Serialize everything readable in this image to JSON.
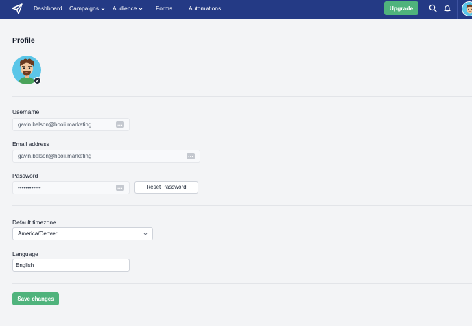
{
  "nav": {
    "items": [
      {
        "label": "Dashboard"
      },
      {
        "label": "Campaigns",
        "has_dropdown": true
      },
      {
        "label": "Audience",
        "has_dropdown": true
      },
      {
        "label": "Forms"
      },
      {
        "label": "Automations"
      }
    ],
    "upgrade_label": "Upgrade",
    "icons": [
      "paper-plane-logo-icon",
      "search-icon",
      "bell-icon",
      "user-avatar"
    ]
  },
  "page": {
    "title": "Profile"
  },
  "form": {
    "username": {
      "label": "Username",
      "value": "gavin.belson@hooli.marketing"
    },
    "email": {
      "label": "Email address",
      "value": "gavin.belson@hooli.marketing"
    },
    "password": {
      "label": "Password",
      "value": "••••••••••••",
      "reset_label": "Reset Password"
    },
    "timezone": {
      "label": "Default timezone",
      "value": "America/Denver"
    },
    "language": {
      "label": "Language",
      "value": "English"
    },
    "save_label": "Save changes"
  },
  "colors": {
    "nav_bg": "#243a85",
    "accent_green": "#4fb37c",
    "page_bg": "#f3f4f6",
    "avatar_bg": "#5bc6e8"
  }
}
